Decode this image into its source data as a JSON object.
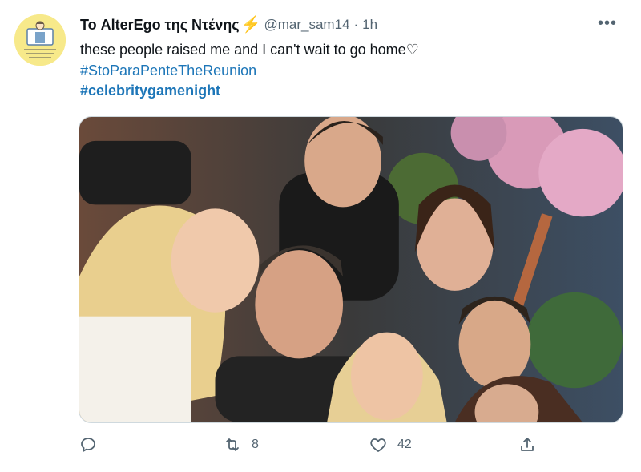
{
  "tweet": {
    "display_name": "Το AlterEgo της Ντένης",
    "handle": "@mar_sam14",
    "separator": "·",
    "time": "1h",
    "text": "these people raised me and I can't wait to go home♡",
    "hashtags": [
      "#StoParaPenteTheReunion",
      "#celebritygamenight"
    ],
    "media_icon": "photo"
  },
  "actions": {
    "reply_icon": "reply-icon",
    "retweet_count": "8",
    "like_count": "42",
    "share_icon": "share-icon"
  },
  "colors": {
    "link": "#1d76b8",
    "secondary_text": "#536471",
    "bolt": "#f4a30c",
    "avatar_bg": "#f7e98a"
  }
}
